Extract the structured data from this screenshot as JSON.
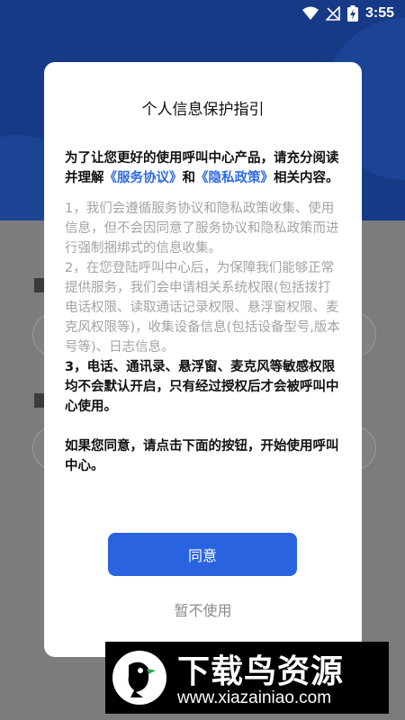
{
  "status_bar": {
    "time": "3:55"
  },
  "dialog": {
    "title": "个人信息保护指引",
    "intro_part1": "为了让您更好的使用呼叫中心产品，请充分阅读并理解",
    "link_service": "《服务协议》",
    "intro_and": "和",
    "link_privacy": "《隐私政策》",
    "intro_part2": "相关内容。",
    "item1": "1，我们会遵循服务协议和隐私政策收集、使用信息，但不会因同意了服务协议和隐私政策而进行强制捆绑式的信息收集。",
    "item2": "2，在您登陆呼叫中心后，为保障我们能够正常提供服务，我们会申请相关系统权限(包括拨打电话权限、读取通话记录权限、悬浮窗权限、麦克风权限等)，收集设备信息(包括设备型号,版本号等)、日志信息。",
    "item3": "3，电话、通讯录、悬浮窗、麦克风等敏感权限均不会默认开启，只有经过授权后才会被呼叫中心使用。",
    "closing": "如果您同意，请点击下面的按钮，开始使用呼叫中心。",
    "agree_label": "同意",
    "decline_label": "暂不使用"
  },
  "watermark": {
    "title": "下载鸟资源",
    "url": "www.xiazainiao.com"
  },
  "colors": {
    "brand_blue": "#2a63df",
    "link_blue": "#2f6ae0",
    "header_bg": "#173a86"
  }
}
